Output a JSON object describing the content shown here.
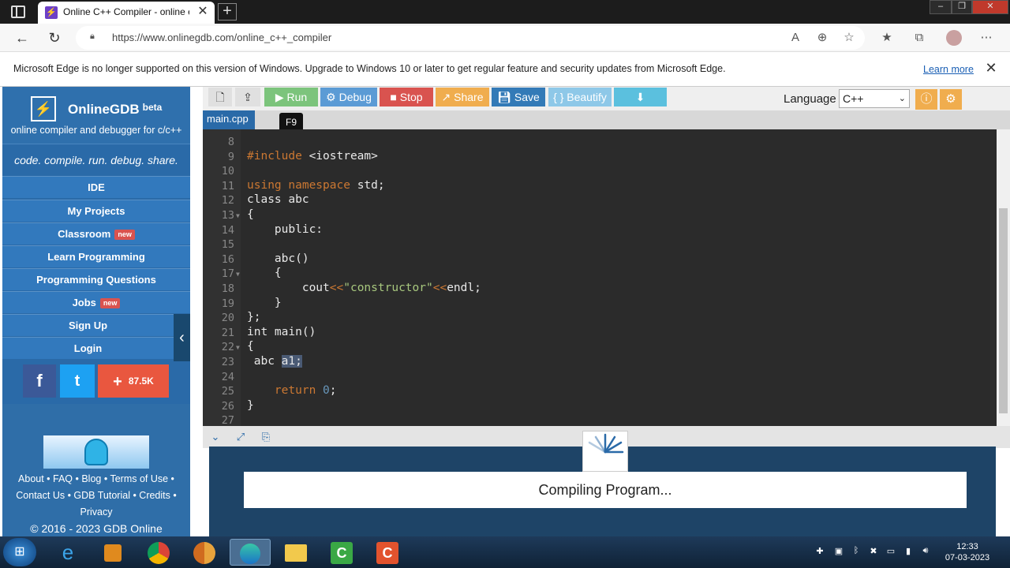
{
  "browser": {
    "tab_title": "Online C++ Compiler - online ed",
    "url": "https://www.onlinegdb.com/online_c++_compiler",
    "new_tab_label": "+",
    "tab_close": "✕"
  },
  "infobar": {
    "message": "Microsoft Edge is no longer supported on this version of Windows. Upgrade to Windows 10 or later to get regular feature and security updates from Microsoft Edge.",
    "learn_more": "Learn more"
  },
  "sidebar": {
    "brand": "OnlineGDB",
    "beta": "beta",
    "subtitle": "online compiler and debugger for c/c++",
    "tagline": "code. compile. run. debug. share.",
    "items": [
      {
        "label": "IDE",
        "badge": ""
      },
      {
        "label": "My Projects",
        "badge": ""
      },
      {
        "label": "Classroom",
        "badge": "new"
      },
      {
        "label": "Learn Programming",
        "badge": ""
      },
      {
        "label": "Programming Questions",
        "badge": ""
      },
      {
        "label": "Jobs",
        "badge": "new"
      },
      {
        "label": "Sign Up",
        "badge": ""
      },
      {
        "label": "Login",
        "badge": ""
      }
    ],
    "social": {
      "facebook": "f",
      "twitter": "t",
      "share_count": "87.5K"
    },
    "footer": {
      "line1": "About • FAQ • Blog • Terms of Use •",
      "line2": "Contact Us • GDB Tutorial • Credits •",
      "line3": "Privacy",
      "copyright": "© 2016 - 2023 GDB Online"
    }
  },
  "toolbar": {
    "run": "Run",
    "debug": "Debug",
    "stop": "Stop",
    "share": "Share",
    "save": "Save",
    "beautify": "{ } Beautify",
    "language_label": "Language",
    "language_value": "C++",
    "run_tooltip": "F9"
  },
  "editor": {
    "file_tab": "main.cpp",
    "lines": [
      {
        "n": "8",
        "code": ""
      },
      {
        "n": "9",
        "code": "#include <iostream>"
      },
      {
        "n": "10",
        "code": ""
      },
      {
        "n": "11",
        "code": "using namespace std;"
      },
      {
        "n": "12",
        "code": "class abc"
      },
      {
        "n": "13",
        "code": "{"
      },
      {
        "n": "14",
        "code": "    public:"
      },
      {
        "n": "15",
        "code": ""
      },
      {
        "n": "16",
        "code": "    abc()"
      },
      {
        "n": "17",
        "code": "    {"
      },
      {
        "n": "18",
        "code": "        cout<<\"constructor\"<<endl;"
      },
      {
        "n": "19",
        "code": "    }"
      },
      {
        "n": "20",
        "code": "};"
      },
      {
        "n": "21",
        "code": "int main()"
      },
      {
        "n": "22",
        "code": "{"
      },
      {
        "n": "23",
        "code": " abc a1;"
      },
      {
        "n": "24",
        "code": ""
      },
      {
        "n": "25",
        "code": "    return 0;"
      },
      {
        "n": "26",
        "code": "}"
      },
      {
        "n": "27",
        "code": ""
      }
    ]
  },
  "output": {
    "status": "Compiling Program..."
  },
  "taskbar": {
    "time": "12:33",
    "date": "07-03-2023"
  },
  "colors": {
    "sidebar": "#2a6aa8",
    "run": "#5cb85c",
    "debug": "#5b9bd5",
    "stop": "#d9534f",
    "share": "#f0ad4e",
    "save": "#337ab7",
    "beautify": "#5bc0de",
    "editor_bg": "#2b2b2b",
    "output_bg": "#1e4467"
  }
}
